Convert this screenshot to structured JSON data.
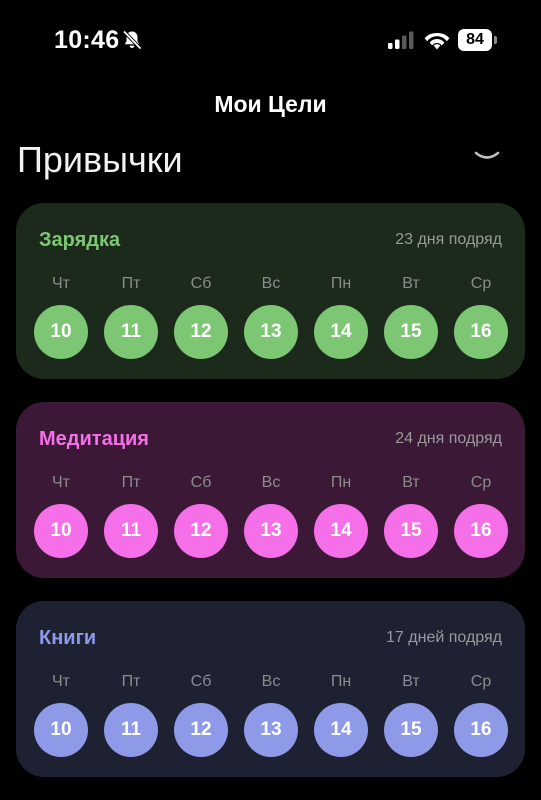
{
  "status_bar": {
    "time": "10:46",
    "battery": "84"
  },
  "nav": {
    "title": "Мои Цели"
  },
  "section": {
    "title": "Привычки"
  },
  "colors": {
    "background": "#000000",
    "green_card": "#1b2a1b",
    "green_accent": "#7dc774",
    "pink_card": "#3a1836",
    "pink_accent": "#f56fe8",
    "blue_card": "#1e2132",
    "blue_accent": "#8e9ae8"
  },
  "habits": [
    {
      "name": "Зарядка",
      "streak": "23 дня подряд",
      "days": [
        {
          "label": "Чт",
          "date": "10"
        },
        {
          "label": "Пт",
          "date": "11"
        },
        {
          "label": "Сб",
          "date": "12"
        },
        {
          "label": "Вс",
          "date": "13"
        },
        {
          "label": "Пн",
          "date": "14"
        },
        {
          "label": "Вт",
          "date": "15"
        },
        {
          "label": "Ср",
          "date": "16"
        }
      ]
    },
    {
      "name": "Медитация",
      "streak": "24 дня подряд",
      "days": [
        {
          "label": "Чт",
          "date": "10"
        },
        {
          "label": "Пт",
          "date": "11"
        },
        {
          "label": "Сб",
          "date": "12"
        },
        {
          "label": "Вс",
          "date": "13"
        },
        {
          "label": "Пн",
          "date": "14"
        },
        {
          "label": "Вт",
          "date": "15"
        },
        {
          "label": "Ср",
          "date": "16"
        }
      ]
    },
    {
      "name": "Книги",
      "streak": "17 дней подряд",
      "days": [
        {
          "label": "Чт",
          "date": "10"
        },
        {
          "label": "Пт",
          "date": "11"
        },
        {
          "label": "Сб",
          "date": "12"
        },
        {
          "label": "Вс",
          "date": "13"
        },
        {
          "label": "Пн",
          "date": "14"
        },
        {
          "label": "Вт",
          "date": "15"
        },
        {
          "label": "Ср",
          "date": "16"
        }
      ]
    }
  ]
}
